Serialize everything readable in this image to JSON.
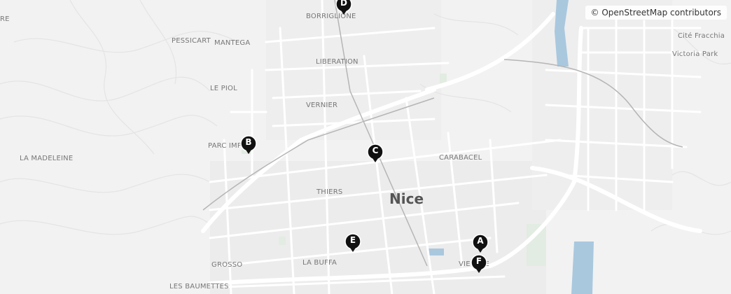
{
  "attribution": "© OpenStreetMap contributors",
  "city_label": "Nice",
  "district_labels": [
    {
      "id": "borriglione",
      "text": "BORRIGLIONE"
    },
    {
      "id": "pessicart",
      "text": "PESSICART"
    },
    {
      "id": "mantega",
      "text": "MANTEGA"
    },
    {
      "id": "liberation",
      "text": "LIBERATION"
    },
    {
      "id": "le-piol",
      "text": "LE PIOL"
    },
    {
      "id": "vernier",
      "text": "VERNIER"
    },
    {
      "id": "parc-imperial",
      "text": "PARC IMP"
    },
    {
      "id": "la-madeleine",
      "text": "LA MADELEINE"
    },
    {
      "id": "carabacel",
      "text": "CARABACEL"
    },
    {
      "id": "thiers",
      "text": "THIERS"
    },
    {
      "id": "grosso",
      "text": "GROSSO"
    },
    {
      "id": "la-buffa",
      "text": "LA BUFFA"
    },
    {
      "id": "les-baumettes",
      "text": "LES BAUMETTES"
    },
    {
      "id": "vieux-nice",
      "text": "VIE    CE"
    },
    {
      "id": "cite-fracchia",
      "text": "Cité Fracchia"
    },
    {
      "id": "victoria-park",
      "text": "Victoria Park"
    },
    {
      "id": "re",
      "text": "RE"
    }
  ],
  "markers": [
    {
      "id": "A",
      "letter": "A"
    },
    {
      "id": "B",
      "letter": "B"
    },
    {
      "id": "C",
      "letter": "C"
    },
    {
      "id": "D",
      "letter": "D"
    },
    {
      "id": "E",
      "letter": "E"
    },
    {
      "id": "F",
      "letter": "F"
    }
  ],
  "colors": {
    "background": "#f2f2f2",
    "roads": "#ffffff",
    "water": "#a9c8de",
    "park": "#e2ece2",
    "marker": "#111111"
  }
}
